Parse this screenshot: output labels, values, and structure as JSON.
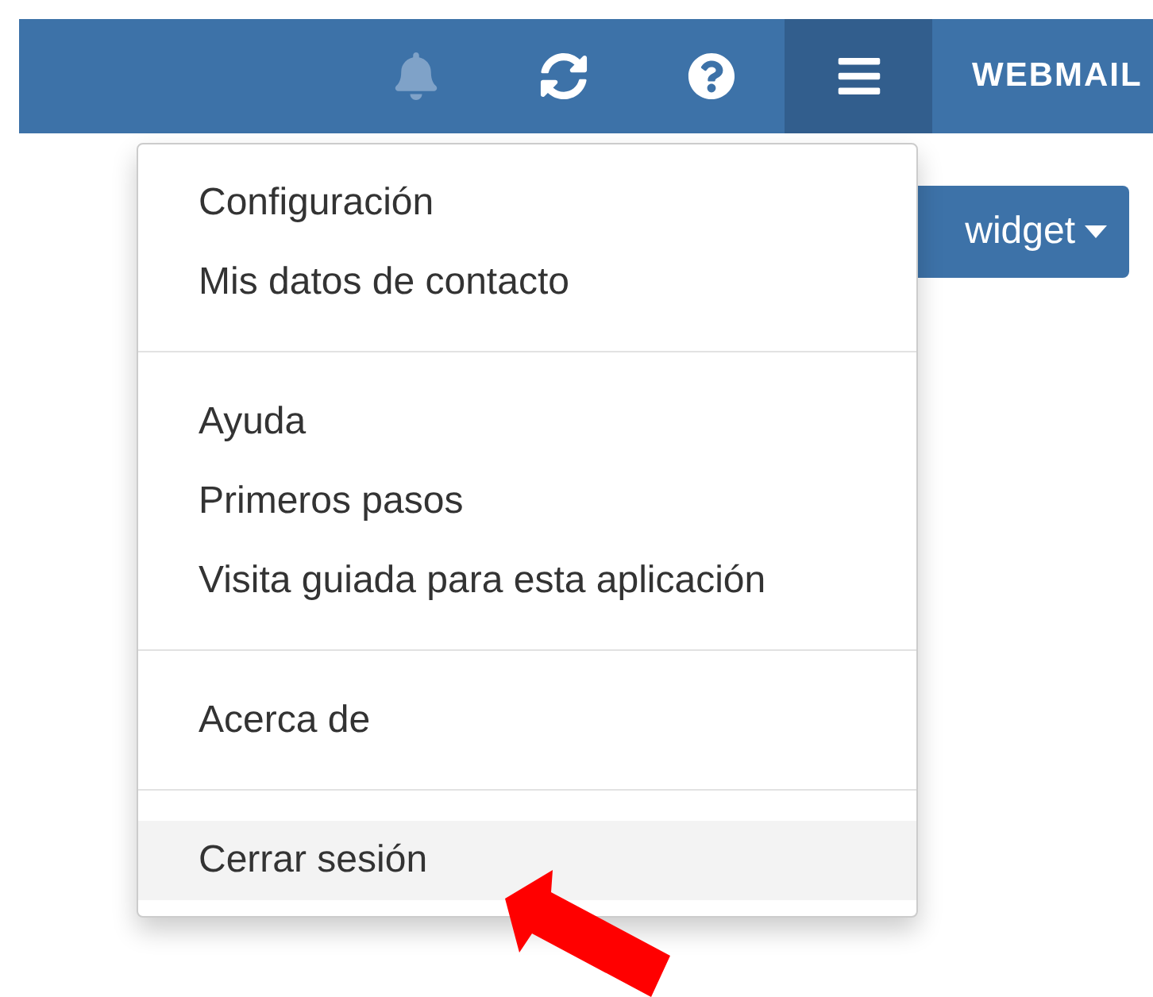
{
  "topbar": {
    "buttons": [
      {
        "kind": "bell",
        "disabled": true,
        "selected": false
      },
      {
        "kind": "refresh",
        "disabled": false,
        "selected": false
      },
      {
        "kind": "help",
        "disabled": false,
        "selected": false
      },
      {
        "kind": "menu",
        "disabled": false,
        "selected": true
      }
    ],
    "brand": "WEBMAIL"
  },
  "widget_button": {
    "label": "widget"
  },
  "menu": {
    "groups": [
      {
        "items": [
          {
            "label": "Configuración",
            "selected": false
          },
          {
            "label": "Mis datos de contacto",
            "selected": false
          }
        ]
      },
      {
        "items": [
          {
            "label": "Ayuda",
            "selected": false
          },
          {
            "label": "Primeros pasos",
            "selected": false
          },
          {
            "label": "Visita guiada para esta aplicación",
            "selected": false
          }
        ]
      },
      {
        "items": [
          {
            "label": "Acerca de",
            "selected": false
          }
        ]
      },
      {
        "items": [
          {
            "label": "Cerrar sesión",
            "selected": true
          }
        ]
      }
    ]
  }
}
